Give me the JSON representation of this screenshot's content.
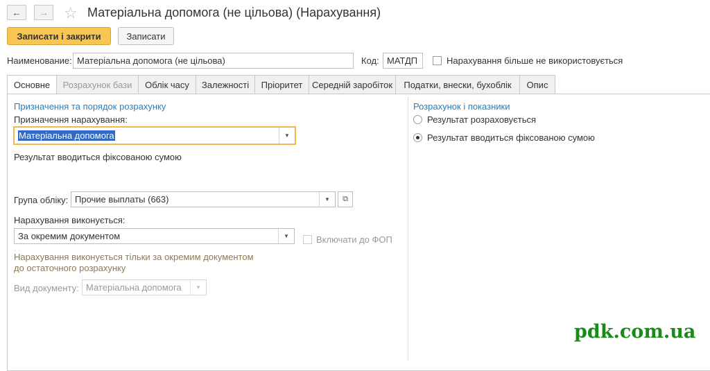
{
  "window": {
    "title": "Матеріальна допомога (не цільова) (Нарахування)"
  },
  "toolbar": {
    "save_close_label": "Записати і закрити",
    "save_label": "Записати"
  },
  "header": {
    "name_label": "Наименование:",
    "name_value": "Матеріальна допомога (не цільова)",
    "code_label": "Код:",
    "code_value": "МАТДП",
    "unused_label": "Нарахування більше не використовується"
  },
  "tabs": [
    {
      "label": "Основне"
    },
    {
      "label": "Розрахунок бази"
    },
    {
      "label": "Облік часу"
    },
    {
      "label": "Залежності"
    },
    {
      "label": "Пріоритет"
    },
    {
      "label": "Середній заробіток"
    },
    {
      "label": "Податки, внески, бухоблік"
    },
    {
      "label": "Опис"
    }
  ],
  "left": {
    "section_title": "Призначення та порядок розрахунку",
    "purpose_label": "Призначення нарахування:",
    "purpose_value": "Матеріальна допомога",
    "result_note": "Результат вводиться фіксованою сумою",
    "group_label": "Група обліку:",
    "group_value": "Прочие выплаты (663)",
    "executed_label": "Нарахування виконується:",
    "executed_value": "За окремим документом",
    "fop_label": "Включати до ФОП",
    "exec_hint_line1": "Нарахування виконується тільки за окремим документом",
    "exec_hint_line2": "до остаточного розрахунку",
    "doc_type_label": "Вид документу:",
    "doc_type_value": "Матеріальна допомога"
  },
  "right": {
    "section_title": "Розрахунок і показники",
    "radio_calculated": "Результат розраховується",
    "radio_fixed": "Результат вводиться фіксованою сумою"
  },
  "watermark": "pdk.com.ua",
  "colors": {
    "accent": "#f7c550",
    "section": "#2a7dbb",
    "focus": "#f2b84b",
    "watermark": "#1a8a1a"
  }
}
